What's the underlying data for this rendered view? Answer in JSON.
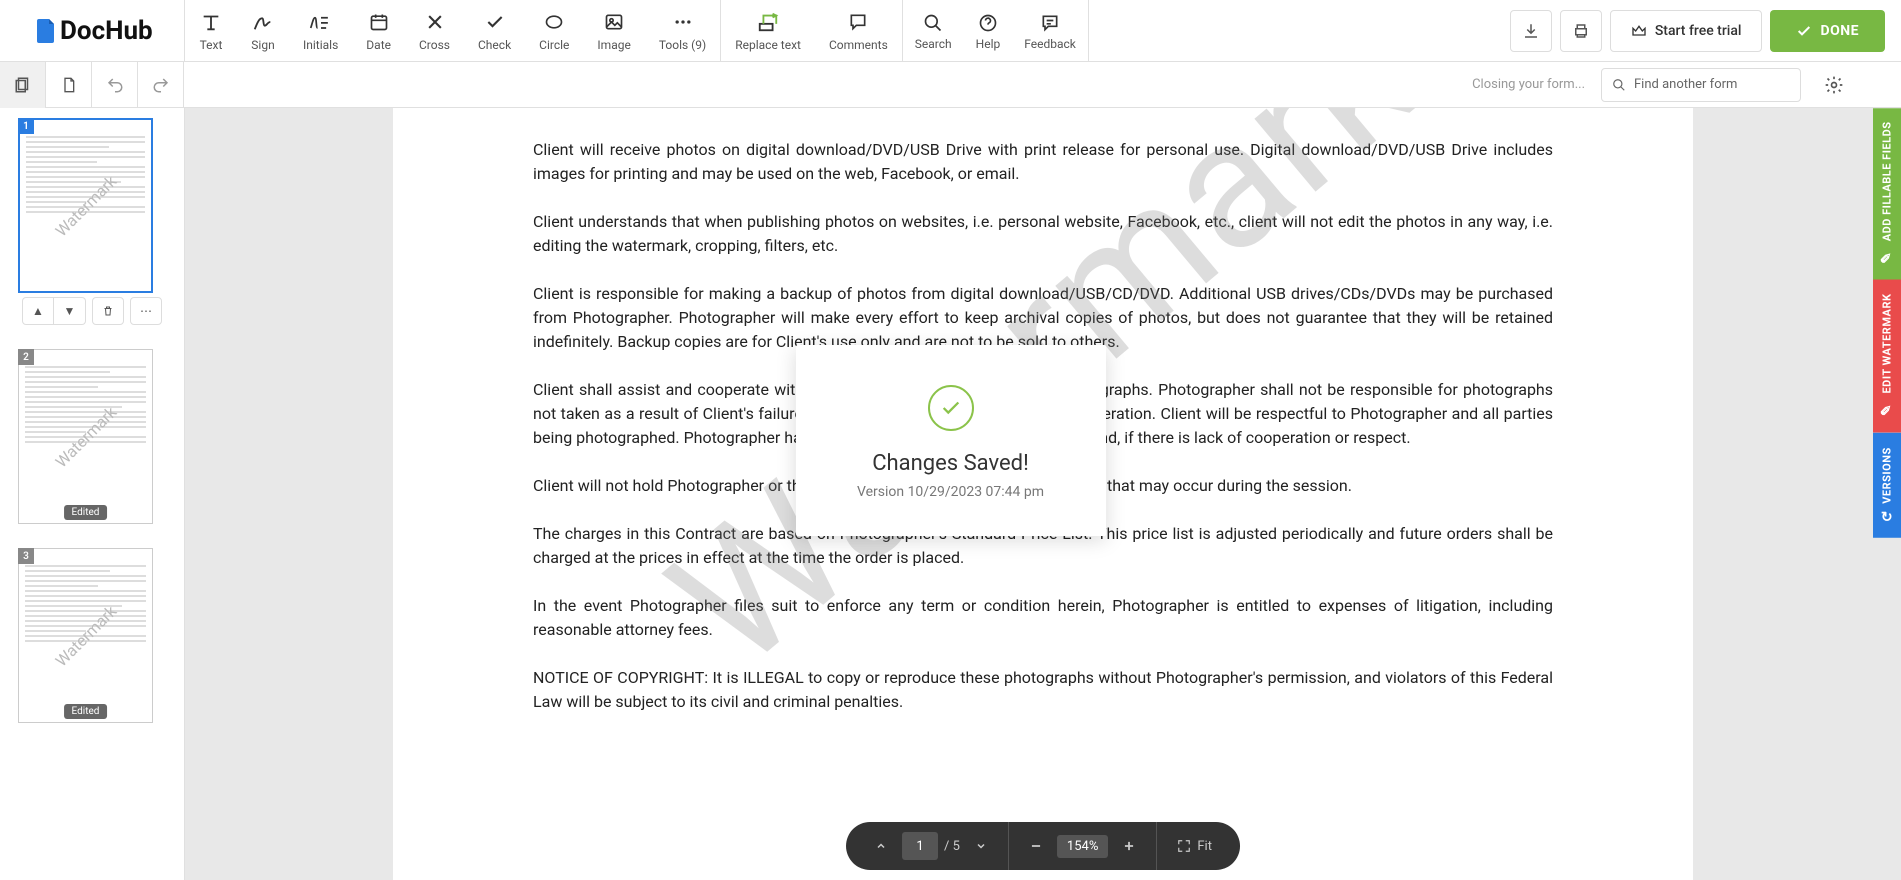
{
  "brand": {
    "name": "DocHub"
  },
  "toolbar": {
    "tools": {
      "text": "Text",
      "sign": "Sign",
      "initials": "Initials",
      "date": "Date",
      "cross": "Cross",
      "check": "Check",
      "circle": "Circle",
      "image": "Image",
      "tools": "Tools (9)"
    },
    "replace_text": "Replace text",
    "comments": "Comments",
    "search": "Search",
    "help": "Help",
    "feedback": "Feedback",
    "start_trial": "Start free trial",
    "done": "DONE"
  },
  "secondary": {
    "closing": "Closing your form...",
    "find_placeholder": "Find another form"
  },
  "thumbnails": [
    {
      "num": "1",
      "watermark": "Watermark",
      "edited": false,
      "active": true
    },
    {
      "num": "2",
      "watermark": "Watermark",
      "edited": true,
      "active": false
    },
    {
      "num": "3",
      "watermark": "Watermark",
      "edited": true,
      "active": false
    }
  ],
  "edited_label": "Edited",
  "document": {
    "watermark": "Watermark",
    "paragraphs": [
      "Client will receive photos on digital download/DVD/USB Drive with print release for personal use. Digital download/DVD/USB Drive includes images for printing and may be used on the web, Facebook, or email.",
      "Client understands that when publishing photos on websites, i.e. personal website, Facebook, etc., client will not edit the photos in any way, i.e. editing the watermark, cropping, filters, etc.",
      "Client is responsible for making a backup of photos from digital download/USB/CD/DVD. Additional USB drives/CDs/DVDs may be purchased from Photographer. Photographer will make every effort to keep archival copies of photos, but does not guarantee that they will be retained indefinitely. Backup copies are for Client's use only and are not to be sold to others.",
      "Client shall assist and cooperate with Photographer in obtaining desired photographs. Photographer shall not be responsible for photographs not taken as a result of Client's failure to provide reasonable assistance or cooperation. Client will be respectful to Photographer and all parties being photographed. Photographer has the right to end the session, without refund, if there is lack of cooperation or respect.",
      "Client will not hold Photographer or the owner of the property liable for any injury that may occur during the session.",
      "The charges in this Contract are based on Photographer's Standard Price List. This price list is adjusted periodically and future orders shall be charged at the prices in effect at the time the order is placed.",
      "In the event Photographer files suit to enforce any term or condition herein, Photographer is entitled to expenses of litigation, including reasonable attorney fees.",
      "NOTICE OF COPYRIGHT: It is ILLEGAL to copy or reproduce these photographs without Photographer's permission, and violators of this Federal Law will be subject to its civil and criminal penalties."
    ]
  },
  "side_tabs": {
    "fillable": "ADD FILLABLE FIELDS",
    "watermark": "EDIT WATERMARK",
    "versions": "VERSIONS"
  },
  "pager": {
    "current": "1",
    "total": "/ 5",
    "zoom": "154%",
    "fit": "Fit"
  },
  "modal": {
    "title": "Changes Saved!",
    "subtitle": "Version 10/29/2023 07:44 pm"
  }
}
